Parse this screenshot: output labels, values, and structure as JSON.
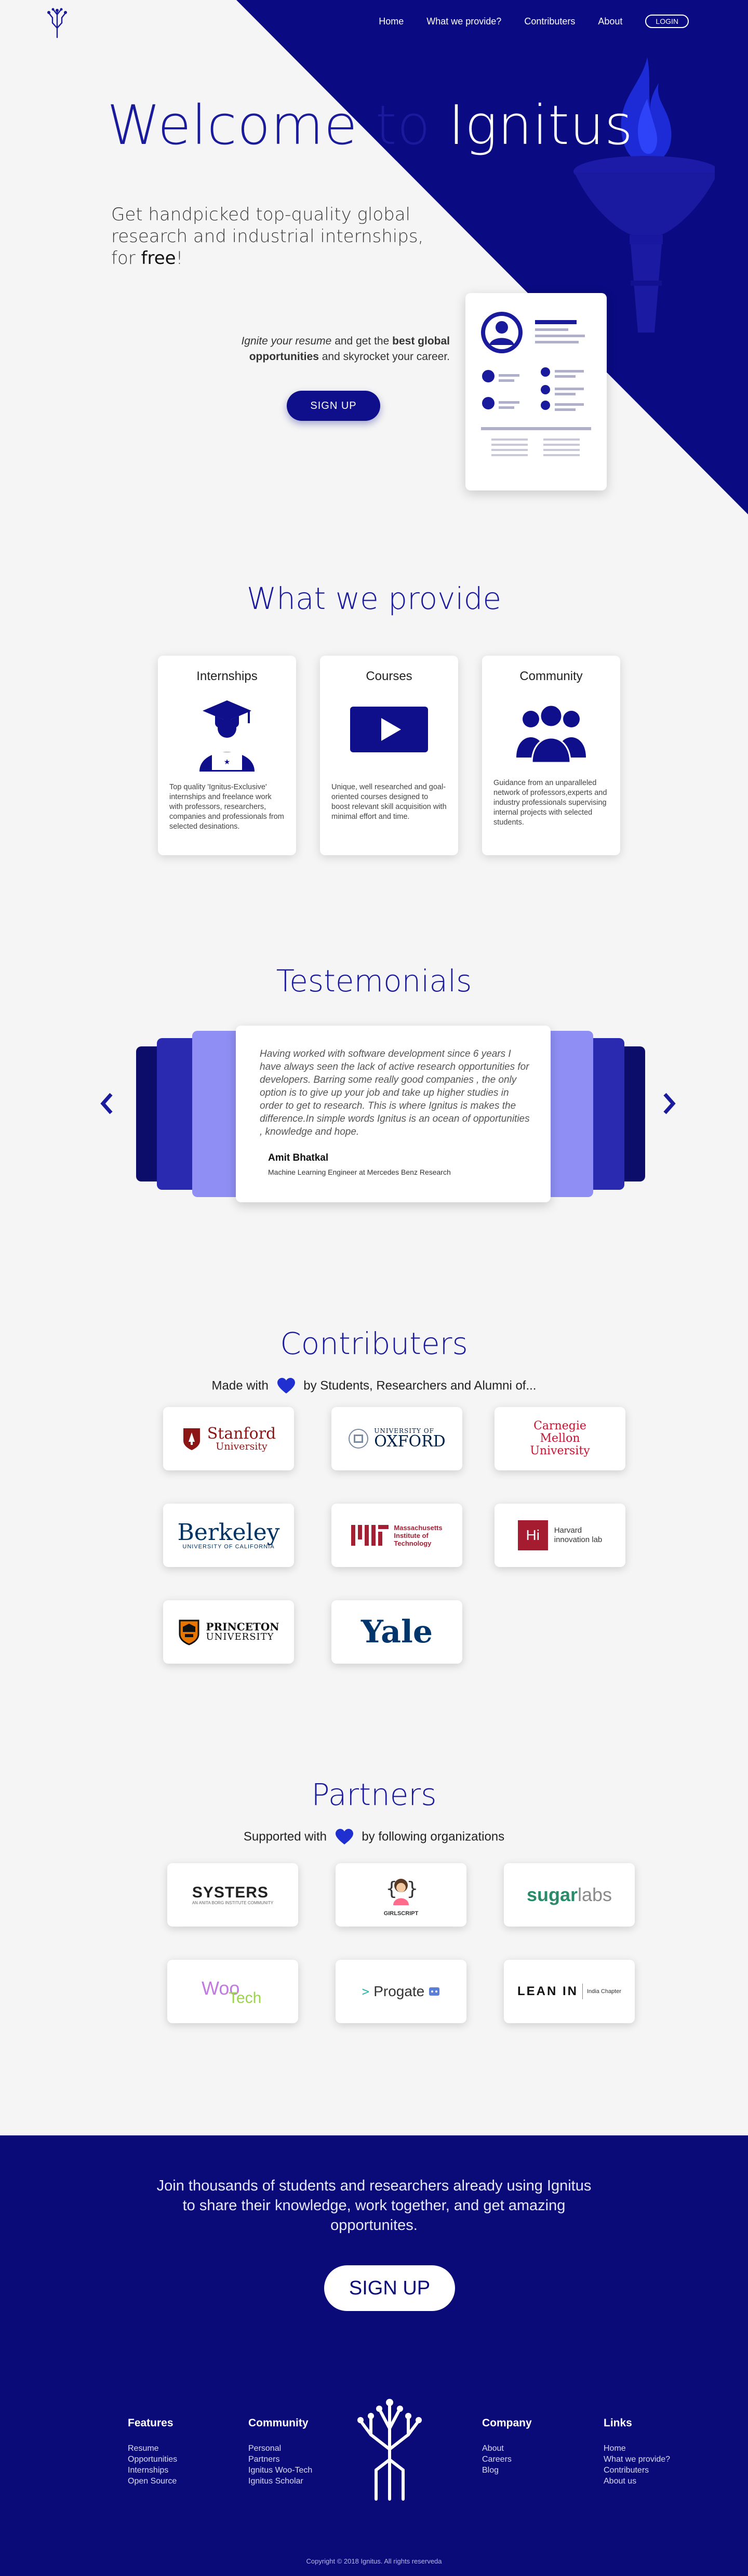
{
  "nav": {
    "links": [
      "Home",
      "What we provide?",
      "Contributers",
      "About"
    ],
    "login": "LOGIN"
  },
  "hero": {
    "title_part1": "Welcome to",
    "title_part2": "Ignitus",
    "subtitle_line": "Get handpicked top-quality global research and industrial internships, for",
    "subtitle_bold": "free",
    "subtitle_end": "!",
    "cta_italic": "Ignite your resume",
    "cta_mid": "and get the",
    "cta_bold": "best global opportunities",
    "cta_end": "and skyrocket your career.",
    "signup": "SIGN UP"
  },
  "provide": {
    "title": "What we provide",
    "cards": [
      {
        "title": "Internships",
        "desc": "Top quality 'Ignitus-Exclusive' internships and freelance work with professors, researchers, companies and professionals from selected desinations."
      },
      {
        "title": "Courses",
        "desc": "Unique, well researched and goal-oriented courses designed to boost relevant skill acquisition with minimal effort and time."
      },
      {
        "title": "Community",
        "desc": "Guidance from an unparalleled network of professors,experts and industry professionals supervising internal projects with selected students."
      }
    ]
  },
  "testimonials": {
    "title": "Testemonials",
    "quote": "Having worked with software development since 6 years I have always seen the lack of active research opportunities for developers. Barring some really good companies , the only option is to give up your job and take up higher studies in order to get to research. This is where Ignitus is makes the difference.In simple words Ignitus is an ocean of opportunities , knowledge and hope.",
    "name": "Amit Bhatkal",
    "role": "Machine Learning Engineer at Mercedes Benz Research"
  },
  "contributers": {
    "title": "Contributers",
    "made_with_pre": "Made with",
    "made_with_post": "by Students, Researchers and Alumni of...",
    "logos": {
      "stanford_1": "Stanford",
      "stanford_2": "University",
      "oxford_1": "UNIVERSITY OF",
      "oxford_2": "OXFORD",
      "cmu_1": "Carnegie",
      "cmu_2": "Mellon",
      "cmu_3": "University",
      "berkeley_1": "Berkeley",
      "berkeley_2": "UNIVERSITY OF CALIFORNIA",
      "mit_1": "Massachusetts",
      "mit_2": "Institute of",
      "mit_3": "Technology",
      "harvard_mark": "Hi",
      "harvard_1": "Harvard",
      "harvard_2": "innovation lab",
      "princeton_1": "PRINCETON",
      "princeton_2": "UNIVERSITY",
      "yale": "Yale"
    }
  },
  "partners": {
    "title": "Partners",
    "supported_pre": "Supported with",
    "supported_post": "by following organizations",
    "logos": {
      "systers_1": "SYSTERS",
      "systers_2": "AN ANITA BORG INSTITUTE COMMUNITY",
      "girlscript": "GIRLSCRIPT",
      "sugar_1": "sugar",
      "sugar_2": "labs",
      "woo_1": "Woo",
      "woo_2": "Tech",
      "progate": "Progate",
      "leanin_1": "LEAN IN",
      "leanin_2": "India Chapter"
    }
  },
  "footer": {
    "join": "Join thousands of students and researchers already using Ignitus to share their knowledge, work together, and get amazing opportunites.",
    "signup": "SIGN UP",
    "columns": [
      {
        "head": "Features",
        "items": [
          "Resume",
          "Opportunities",
          "Internships",
          "Open Source"
        ]
      },
      {
        "head": "Community",
        "items": [
          "Personal",
          "Partners",
          "Ignitus Woo-Tech",
          "Ignitus Scholar"
        ]
      },
      {
        "head": "Company",
        "items": [
          "About",
          "Careers",
          "Blog"
        ]
      },
      {
        "head": "Links",
        "items": [
          "Home",
          "What we provide?",
          "Contributers",
          "About us"
        ]
      }
    ],
    "copyright": "Copyright © 2018 Ignitus. All rights reserveda"
  },
  "colors": {
    "brand": "#0f0f8c",
    "accent": "#1a1a9c",
    "footer": "#0a0a78",
    "light_blue": "#8e8ef5"
  }
}
